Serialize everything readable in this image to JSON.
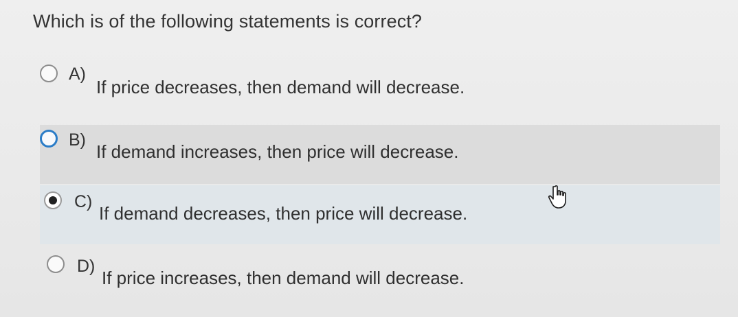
{
  "question": {
    "text": "Which is of the following statements is correct?"
  },
  "options": [
    {
      "letter": "A)",
      "text": "If price decreases, then demand will decrease.",
      "checked": false
    },
    {
      "letter": "B)",
      "text": "If demand increases, then price will decrease.",
      "checked": false
    },
    {
      "letter": "C)",
      "text": "If demand decreases, then price will decrease.",
      "checked": true
    },
    {
      "letter": "D)",
      "text": "If price increases, then demand will decrease.",
      "checked": false
    }
  ],
  "colors": {
    "hover_ring": "#2a7cc7",
    "hover_background": "#dcdcdc",
    "selected_background": "#e0e6ea"
  },
  "icons": {
    "cursor": "hand-pointer-icon"
  }
}
